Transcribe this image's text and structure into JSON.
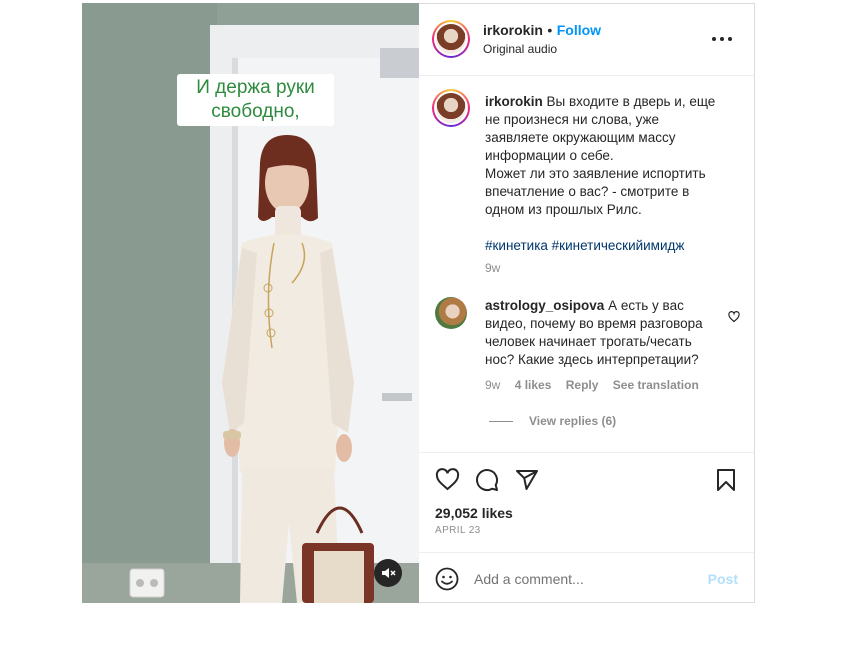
{
  "media": {
    "caption_lines": [
      "И держа руки",
      "свободно,"
    ],
    "mute_icon": "speaker-muted-icon"
  },
  "header": {
    "username": "irkorokin",
    "separator": "•",
    "follow_label": "Follow",
    "subtitle": "Original audio",
    "more_icon": "more-options-icon"
  },
  "caption": {
    "username": "irkorokin",
    "text_lines": [
      "Вы входите в дверь и, еще",
      "не произнеся ни слова, уже",
      "заявляете окружающим массу",
      "информации о себе.",
      "Может ли это заявление испортить",
      "впечатление о вас? - смотрите в",
      "одном из прошлых Рилс."
    ],
    "hashtags": [
      "#кинетика",
      "#кинетическийимидж"
    ],
    "time": "9w"
  },
  "comment": {
    "username": "astrology_osipova",
    "text_lines": [
      "А есть у вас",
      "видео, почему во время разговора",
      "человек начинает трогать/чесать",
      "нос? Какие здесь интерпретации?"
    ],
    "time": "9w",
    "likes": "4 likes",
    "reply_label": "Reply",
    "translate_label": "See translation",
    "view_replies": "View replies (6)"
  },
  "actions": {
    "likes": "29,052 likes",
    "date": "APRIL 23"
  },
  "add_comment": {
    "placeholder": "Add a comment...",
    "post_label": "Post"
  },
  "colors": {
    "link_blue": "#0095f6",
    "hashtag": "#00376b",
    "caption_green": "#2e8b3e",
    "muted_text": "#8e8e8e"
  }
}
